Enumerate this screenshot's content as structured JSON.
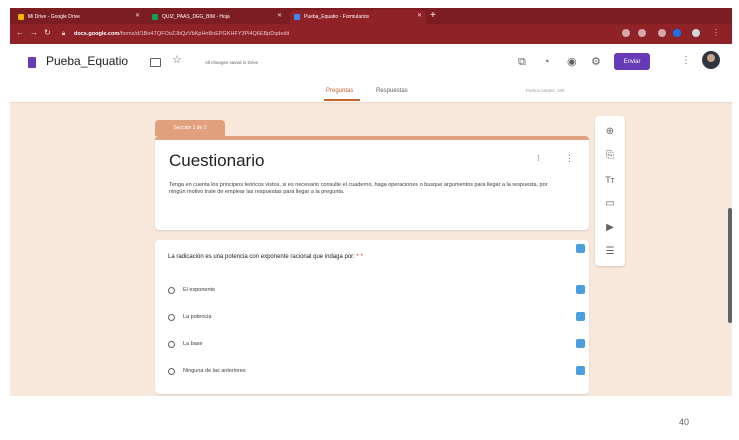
{
  "browser": {
    "tabs": [
      {
        "label": "Mi Drive - Google Drive",
        "color": "#f4b400"
      },
      {
        "label": "QUIZ_PAAS_DEG_BIM - Hoja",
        "color": "#0f9d58"
      },
      {
        "label": "Pueba_Equatio - Formularios",
        "color": "#673ab7"
      }
    ],
    "new_tab_glyph": "+",
    "url_domain": "docs.google.com",
    "url_path": "/forms/d/1Bo4TQFOoZJbQzVbKpHnBnEPGKHFY3Pl4Q6EBpDqdedit"
  },
  "header": {
    "title": "Pueba_Equatio",
    "saved_status": "All changes saved in Drive",
    "send_label": "Enviar"
  },
  "form_tabs": {
    "questions": "Preguntas",
    "responses": "Respuestas",
    "points": "Puntos totales: 100"
  },
  "section": {
    "tag": "Sección 1 de 2",
    "title": "Cuestionario",
    "description": "Tenga en cuenta los principios teóricos vistos, si es necesario consulte el cuaderno, haga operaciones o busque argumentos para llegar a la respuesta, por ningún motivo trate de emplear las respuestas para llegar a la pregunta."
  },
  "question": {
    "text": "La radicación es una potencia con exponente racional que indaga por:",
    "required_mark": " * *",
    "options": [
      "El exponente",
      "La potencia",
      "La base",
      "Ninguna de las anteriores"
    ]
  },
  "toolbar": {
    "icons": [
      "add-question-icon",
      "import-questions-icon",
      "add-title-icon",
      "add-image-icon",
      "add-video-icon",
      "add-section-icon"
    ]
  },
  "footer": {
    "page_number": "40"
  },
  "colors": {
    "accent": "#673ab7",
    "theme": "#e1a07d",
    "background": "#f9e8dc",
    "tab_active": "#c8612c"
  }
}
